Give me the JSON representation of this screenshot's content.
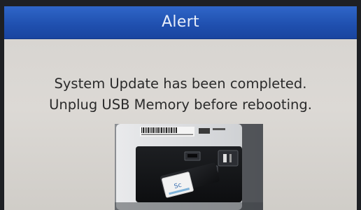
{
  "dialog": {
    "title": "Alert",
    "message_lines": [
      "System Update has been completed.",
      "Unplug USB Memory before rebooting."
    ]
  },
  "photo": {
    "label_text": "Sc",
    "subject": "USB memory stick plugged into device"
  },
  "colors": {
    "title_bar": "#1f4fae",
    "title_text": "#e8eef9",
    "screen_background": "#d8d5d1",
    "message_text": "#2a2a2a"
  }
}
